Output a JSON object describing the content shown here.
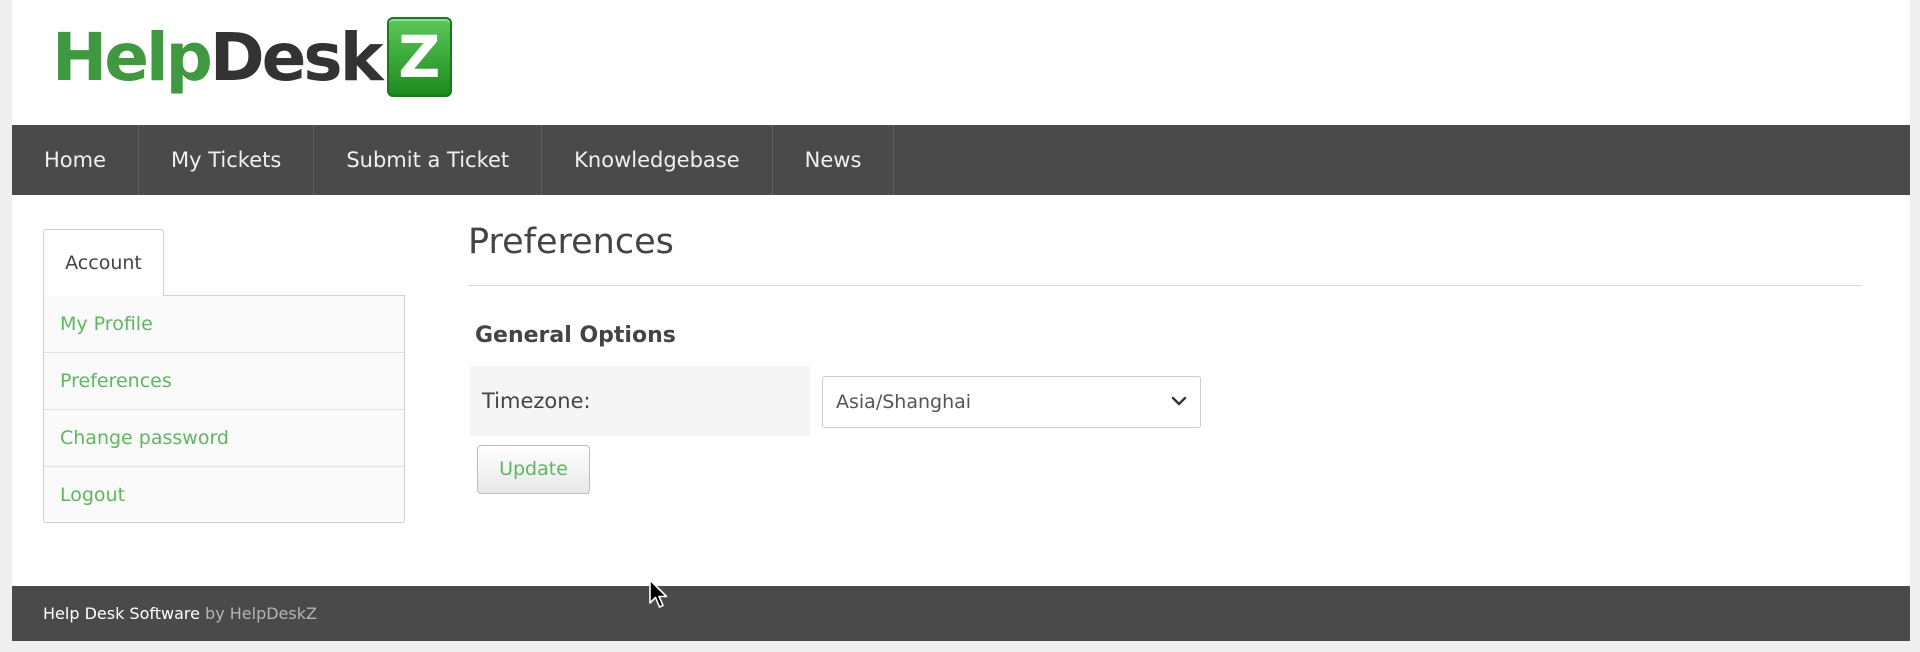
{
  "logo": {
    "part_help": "Help",
    "part_desk": "Desk",
    "part_z": "Z",
    "colors": {
      "green": "#3f9a3f",
      "dark": "#333333",
      "badge": "#2f9e2f"
    }
  },
  "nav": {
    "items": [
      {
        "label": "Home"
      },
      {
        "label": "My Tickets"
      },
      {
        "label": "Submit a Ticket"
      },
      {
        "label": "Knowledgebase"
      },
      {
        "label": "News"
      }
    ]
  },
  "sidebar": {
    "tab_label": "Account",
    "items": [
      {
        "label": "My Profile"
      },
      {
        "label": "Preferences"
      },
      {
        "label": "Change password"
      },
      {
        "label": "Logout"
      }
    ]
  },
  "main": {
    "title": "Preferences",
    "section_title": "General Options",
    "timezone_label": "Timezone:",
    "timezone_value": "Asia/Shanghai",
    "update_label": "Update"
  },
  "footer": {
    "main_text": "Help Desk Software",
    "by_text": " by HelpDeskZ"
  },
  "theme": {
    "nav_bg": "#4a4a4a",
    "link_green": "#5cb85c"
  }
}
